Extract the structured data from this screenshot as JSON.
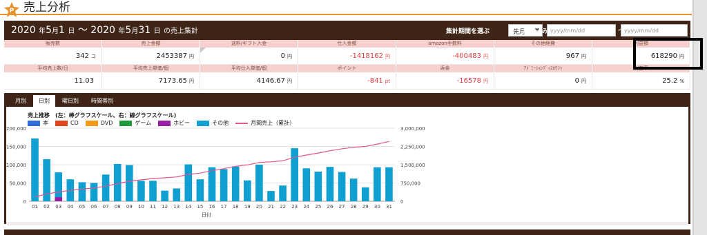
{
  "page": {
    "title": "売上分析"
  },
  "period": {
    "y1": "2020",
    "t_year": "年",
    "m1": "5",
    "t_month": "月",
    "d1": "1",
    "t_day": "日",
    "sep": "〜",
    "y2": "2020",
    "m2": "5",
    "d2": "31",
    "suffix": "の売上集計"
  },
  "controls": {
    "period_label": "集計期間を選ぶ",
    "period_value": "先月",
    "filter_label": "絞り込み",
    "from_placeholder": "yyyy/mm/dd",
    "tilde": "〜",
    "to_placeholder": "yyyy/mm/dd"
  },
  "stats": {
    "row1_headers": [
      "販売数",
      "売上金額",
      "送料/ギフト入金",
      "仕入金額",
      "amazon手数料",
      "その他経費",
      "利益額"
    ],
    "row1_values": [
      {
        "value": "342",
        "unit": "コ",
        "neg": false
      },
      {
        "value": "2453387",
        "unit": "円",
        "neg": false
      },
      {
        "value": "0",
        "unit": "円",
        "neg": false
      },
      {
        "value": "-1418162",
        "unit": "円",
        "neg": true
      },
      {
        "value": "-400483",
        "unit": "円",
        "neg": true
      },
      {
        "value": "967",
        "unit": "円",
        "neg": false
      },
      {
        "value": "618290",
        "unit": "円",
        "neg": false
      }
    ],
    "row2_headers": [
      "平均売上数/日",
      "平均売上単価/個",
      "平均仕入単価/個",
      "ポイント",
      "返金",
      "ｱﾄﾞﾐｰｼｮﾝﾃﾞｨｽｶｳﾝﾄ",
      "利益率"
    ],
    "row2_values": [
      {
        "value": "11.03",
        "unit": "",
        "neg": false
      },
      {
        "value": "7173.65",
        "unit": "円",
        "neg": false
      },
      {
        "value": "4146.67",
        "unit": "円",
        "neg": false
      },
      {
        "value": "-841",
        "unit": "pt",
        "neg": true
      },
      {
        "value": "-16578",
        "unit": "円",
        "neg": true
      },
      {
        "value": "0",
        "unit": "円",
        "neg": false
      },
      {
        "value": "25.2",
        "unit": "%",
        "neg": false
      }
    ]
  },
  "tabs": [
    "月別",
    "日別",
    "曜日別",
    "時間帯別"
  ],
  "active_tab": "日別",
  "colors": {
    "brand_dark": "#3e2517",
    "accent_orange": "#e6902e",
    "header_pink": "#f6d0cd",
    "negative": "#e53a3a",
    "bar_other": "#0f9fd0",
    "bar_cd": "#9b1fa6",
    "line": "#e0558a"
  },
  "chart_data": {
    "type": "bar",
    "title": "売上推移　(左：棒グラフスケール、右：線グラフスケール)",
    "legend": [
      {
        "name": "本",
        "color": "#2f6fd6",
        "kind": "bar"
      },
      {
        "name": "CD",
        "color": "#e0451f",
        "kind": "bar"
      },
      {
        "name": "DVD",
        "color": "#f29a18",
        "kind": "bar"
      },
      {
        "name": "ゲーム",
        "color": "#1e9a3a",
        "kind": "bar"
      },
      {
        "name": "ホビー",
        "color": "#9b1fa6",
        "kind": "bar"
      },
      {
        "name": "その他",
        "color": "#0f9fd0",
        "kind": "bar"
      },
      {
        "name": "月間売上（累計）",
        "color": "#e0558a",
        "kind": "line"
      }
    ],
    "xlabel": "日付",
    "categories": [
      "01",
      "02",
      "03",
      "04",
      "05",
      "06",
      "07",
      "08",
      "09",
      "10",
      "11",
      "12",
      "13",
      "14",
      "15",
      "16",
      "17",
      "18",
      "19",
      "20",
      "21",
      "22",
      "23",
      "24",
      "25",
      "26",
      "27",
      "28",
      "29",
      "30",
      "31"
    ],
    "yticks_left": [
      "0",
      "50,000",
      "100,000",
      "150,000",
      "200,000"
    ],
    "ylim_left": [
      0,
      200000
    ],
    "yticks_right": [
      "0",
      "750,000",
      "1,500,000",
      "2,250,000",
      "3,000,000"
    ],
    "ylim_right": [
      0,
      3000000
    ],
    "series": [
      {
        "name": "その他",
        "type": "bar",
        "values": [
          172000,
          115000,
          79000,
          60000,
          52000,
          50000,
          73000,
          102000,
          99000,
          56000,
          56000,
          29000,
          35000,
          101000,
          60000,
          93000,
          88000,
          95000,
          57000,
          100000,
          28000,
          43000,
          145000,
          90000,
          81000,
          94000,
          80000,
          62000,
          38000,
          93000,
          93000
        ]
      },
      {
        "name": "ホビー",
        "type": "bar",
        "values": [
          0,
          0,
          11000,
          0,
          0,
          0,
          0,
          0,
          0,
          0,
          0,
          0,
          0,
          0,
          0,
          0,
          0,
          0,
          0,
          0,
          0,
          0,
          0,
          0,
          0,
          0,
          0,
          0,
          0,
          0,
          0
        ]
      },
      {
        "name": "月間売上（累計）",
        "type": "line",
        "axis": "right",
        "values": [
          180000,
          295000,
          385000,
          445000,
          497000,
          547000,
          620000,
          722000,
          821000,
          877000,
          933000,
          962000,
          997000,
          1098000,
          1158000,
          1251000,
          1339000,
          1434000,
          1491000,
          1591000,
          1619000,
          1662000,
          1807000,
          1897000,
          1978000,
          2072000,
          2152000,
          2214000,
          2252000,
          2345000,
          2453387
        ]
      }
    ]
  }
}
